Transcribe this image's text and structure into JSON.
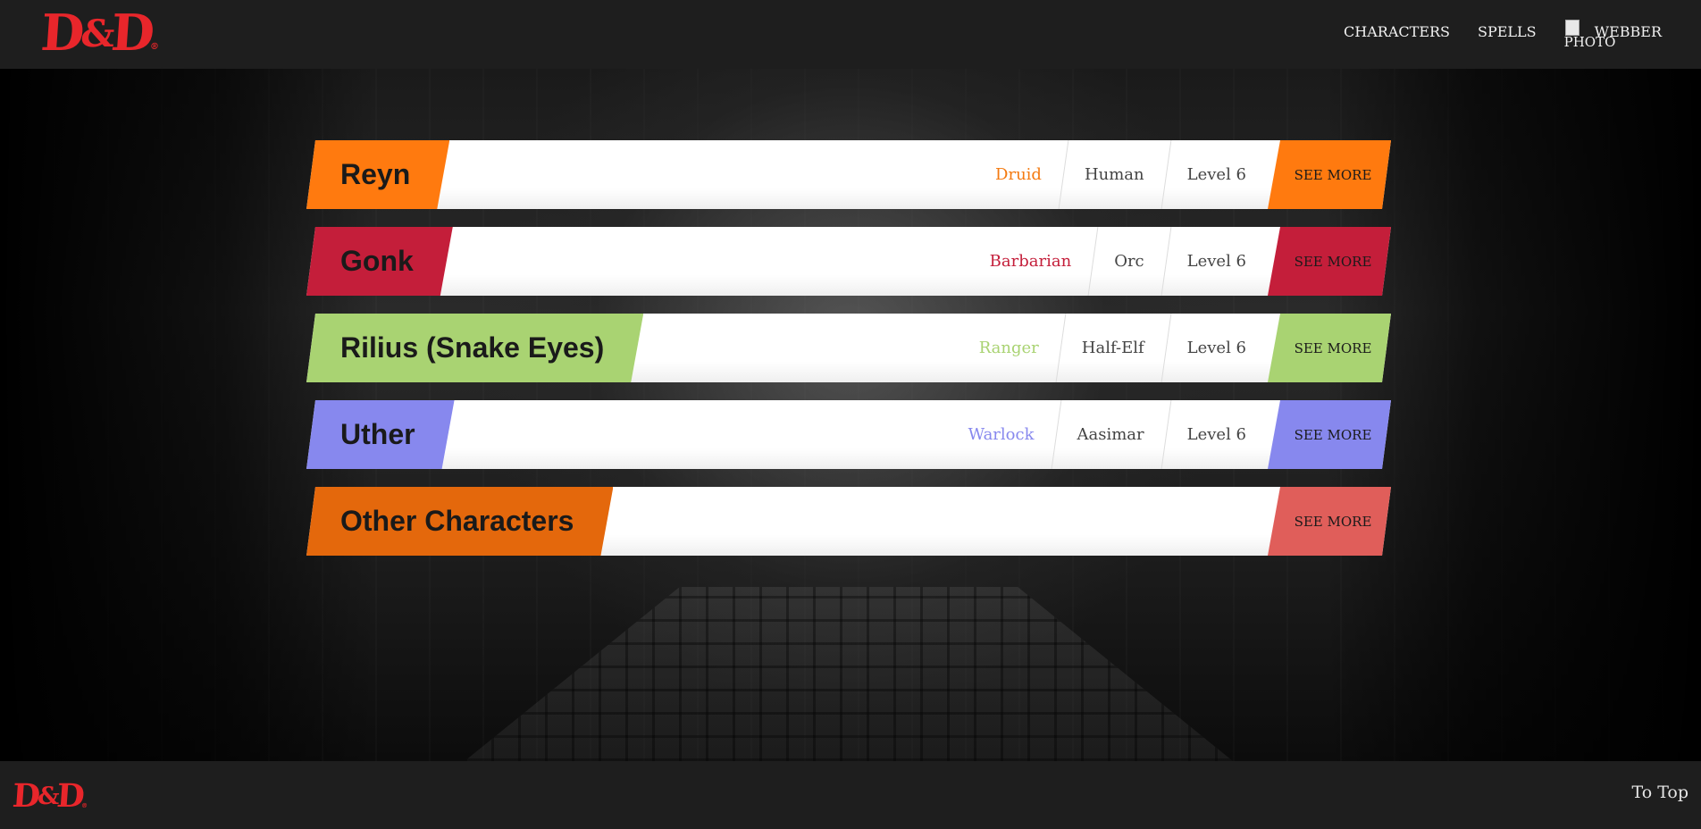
{
  "header": {
    "logo_text_left": "D",
    "logo_text_amp": "&",
    "logo_text_right": "D",
    "logo_reg": "®",
    "nav": [
      {
        "label": "CHARACTERS"
      },
      {
        "label": "SPELLS"
      }
    ],
    "user": {
      "photo_alt": "PHOTO",
      "name": "WEBBER"
    }
  },
  "characters": [
    {
      "name": "Reyn",
      "class": "Druid",
      "race": "Human",
      "level": "Level 6",
      "see_more": "SEE MORE",
      "accent": "#ff7a0f",
      "class_color": "#f47a10",
      "button_color": "#ff7a0f"
    },
    {
      "name": "Gonk",
      "class": "Barbarian",
      "race": "Orc",
      "level": "Level 6",
      "see_more": "SEE MORE",
      "accent": "#c41e3a",
      "class_color": "#c41e3a",
      "button_color": "#c41e3a"
    },
    {
      "name": "Rilius (Snake Eyes)",
      "class": "Ranger",
      "race": "Half-Elf",
      "level": "Level 6",
      "see_more": "SEE MORE",
      "accent": "#a9d372",
      "class_color": "#a9d372",
      "button_color": "#a9d372"
    },
    {
      "name": "Uther",
      "class": "Warlock",
      "race": "Aasimar",
      "level": "Level 6",
      "see_more": "SEE MORE",
      "accent": "#8788ee",
      "class_color": "#8788ee",
      "button_color": "#8788ee"
    }
  ],
  "other": {
    "name": "Other Characters",
    "see_more": "SEE MORE",
    "accent": "#e4680c",
    "button_color": "#e05e5a"
  },
  "footer": {
    "logo_text_left": "D",
    "logo_text_amp": "&",
    "logo_text_right": "D",
    "logo_reg": "®",
    "to_top": "To Top"
  }
}
